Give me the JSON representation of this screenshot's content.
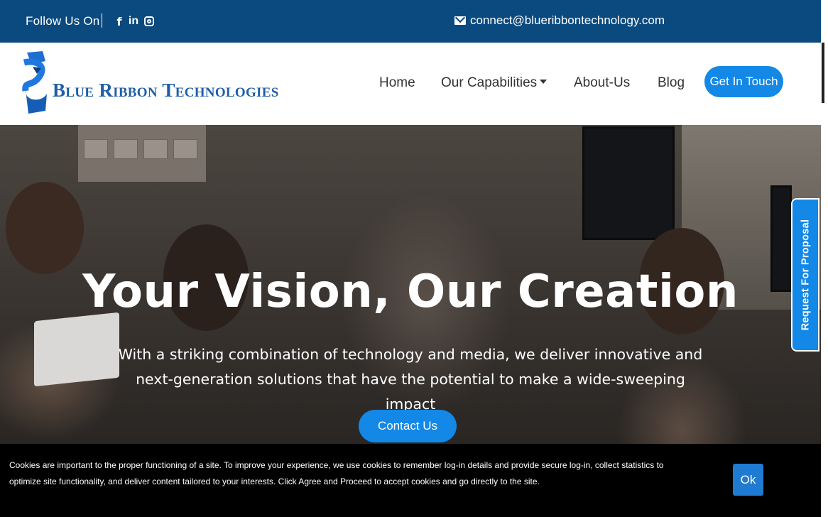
{
  "topbar": {
    "follow_label": "Follow Us On",
    "social": [
      {
        "icon": "facebook-icon",
        "glyph": "f"
      },
      {
        "icon": "linkedin-icon",
        "glyph": "in"
      },
      {
        "icon": "instagram-icon",
        "glyph": ""
      }
    ],
    "email": "connect@blueribbontechnology.com",
    "email_icon": "envelope-icon",
    "background": "#0b4a7e"
  },
  "brand": {
    "name": "Blue Ribbon Technologies",
    "color": "#1f5fa8"
  },
  "nav": {
    "items": [
      {
        "label": "Home"
      },
      {
        "label": "Our Capabilities",
        "has_dropdown": true
      },
      {
        "label": "About-Us"
      },
      {
        "label": "Blog"
      }
    ],
    "cta": "Get In Touch"
  },
  "hero": {
    "title": "Your Vision, Our Creation",
    "subtitle": "With a striking combination of technology and media, we deliver innovative and next-generation solutions that have the potential to make a wide-sweeping impact",
    "button": "Contact Us",
    "accent": "#1388e6"
  },
  "side_tab": {
    "label": "Request For Proposal"
  },
  "cookie": {
    "text": "Cookies are important to the proper functioning of a site. To improve your experience, we use cookies to remember log-in details and provide secure log-in, collect statistics to optimize site functionality, and deliver content tailored to your interests. Click Agree and Proceed to accept cookies and go directly to the site.",
    "button": "Ok"
  }
}
